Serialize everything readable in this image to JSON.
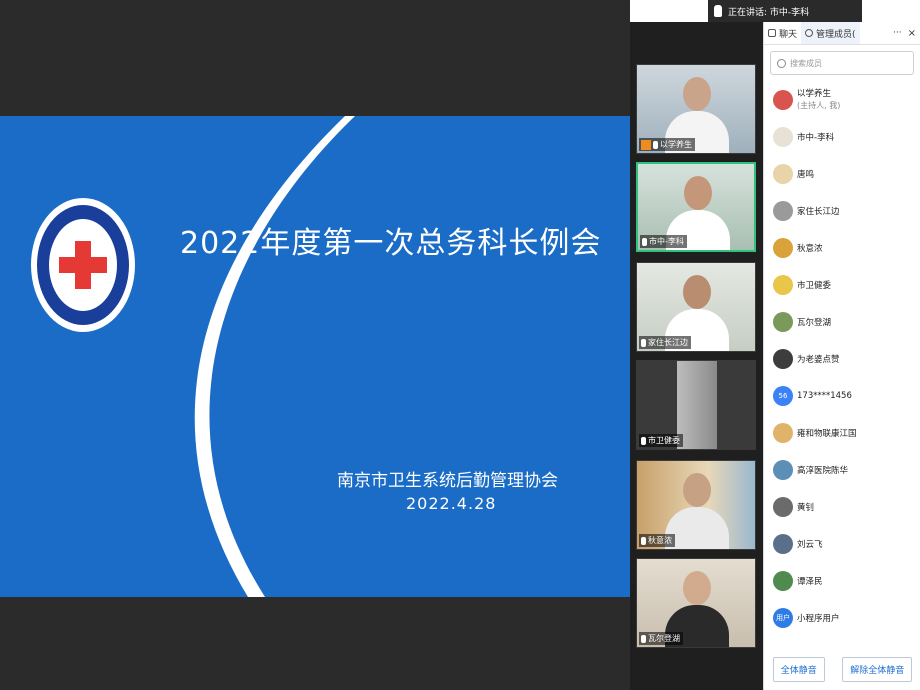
{
  "slide": {
    "title": "2022年度第一次总务科长例会",
    "org": "南京市卫生系统后勤管理协会",
    "date": "2022.4.28",
    "logo_text": "南京市卫生系统后勤管理协会"
  },
  "speaker_bar": {
    "text": "正在讲话: 市中-李科"
  },
  "videos": [
    {
      "name": "以学养生",
      "host": true
    },
    {
      "name": "市中-李科",
      "host": false
    },
    {
      "name": "家住长江边",
      "host": false
    },
    {
      "name": "市卫健委",
      "host": false
    },
    {
      "name": "秋意浓",
      "host": false
    },
    {
      "name": "瓦尔登湖",
      "host": false
    }
  ],
  "panel": {
    "tab_chat": "聊天",
    "tab_members": "管理成员(",
    "more": "···",
    "close": "×",
    "search_placeholder": "搜索成员",
    "members": [
      {
        "name": "以学养生",
        "sub": "(主持人, 我)",
        "color": "#d9534f"
      },
      {
        "name": "市中-李科",
        "color": "#e8e1d5"
      },
      {
        "name": "唐鸣",
        "color": "#e9d3a8"
      },
      {
        "name": "家住长江边",
        "color": "#9a9a9a"
      },
      {
        "name": "秋意浓",
        "color": "#d9a23b"
      },
      {
        "name": "市卫健委",
        "color": "#e9c54a"
      },
      {
        "name": "瓦尔登湖",
        "color": "#7a9a5c"
      },
      {
        "name": "为老婆点赞",
        "color": "#3d3d3d"
      },
      {
        "name": "173****1456",
        "avatar_text": "56",
        "color": "#3b82f6"
      },
      {
        "name": "雍和物联康江国",
        "color": "#e0b36a"
      },
      {
        "name": "高淳医院陈华",
        "color": "#5c8fb5"
      },
      {
        "name": "黄钊",
        "color": "#6b6b6b"
      },
      {
        "name": "刘云飞",
        "color": "#5a6f8a"
      },
      {
        "name": "谭泽民",
        "color": "#4f8a4f"
      },
      {
        "name": "小程序用户",
        "avatar_text": "用户",
        "color": "#2f7ce6"
      }
    ],
    "mute_all": "全体静音",
    "unmute_all": "解除全体静音"
  }
}
